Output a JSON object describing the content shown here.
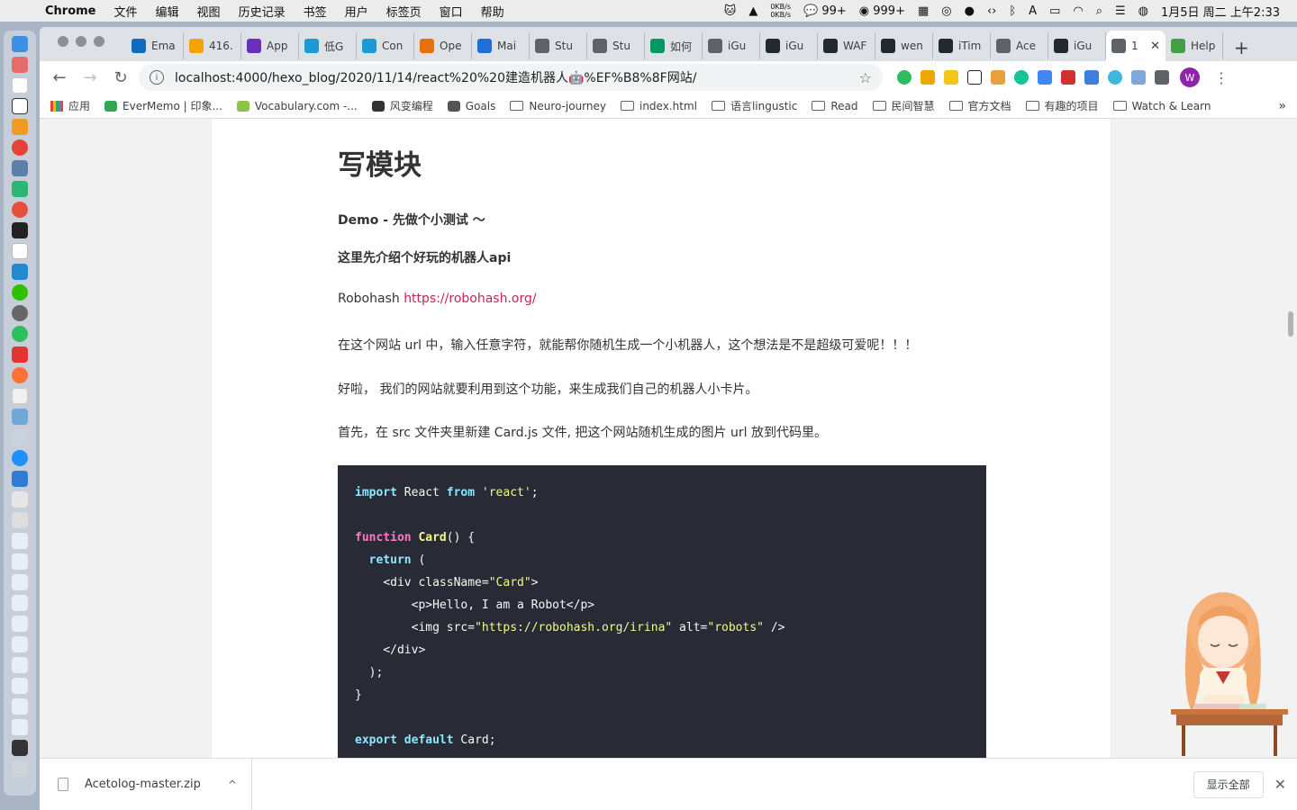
{
  "menubar": {
    "app_name": "Chrome",
    "items": [
      "文件",
      "编辑",
      "视图",
      "历史记录",
      "书签",
      "用户",
      "标签页",
      "窗口",
      "帮助"
    ],
    "net_up": "0KB/s",
    "net_down": "0KB/s",
    "wechat_count": "99+",
    "badge_count": "999+",
    "datetime": "1月5日 周二 上午2:33"
  },
  "tabs": [
    {
      "label": "Ema",
      "color": "#0f6cbd"
    },
    {
      "label": "416.",
      "color": "#f4a300"
    },
    {
      "label": "App",
      "color": "#6b2fbf"
    },
    {
      "label": "低G",
      "color": "#1a9bd7"
    },
    {
      "label": "Con",
      "color": "#1a9bd7"
    },
    {
      "label": "Ope",
      "color": "#e8710a"
    },
    {
      "label": "Mai",
      "color": "#1e6fd9"
    },
    {
      "label": "Stu",
      "color": "#5f6368"
    },
    {
      "label": "Stu",
      "color": "#5f6368"
    },
    {
      "label": "如何",
      "color": "#009a61"
    },
    {
      "label": "iGu",
      "color": "#5f6368"
    },
    {
      "label": "iGu",
      "color": "#24292e"
    },
    {
      "label": "WAF",
      "color": "#24292e"
    },
    {
      "label": "wen",
      "color": "#24292e"
    },
    {
      "label": "iTim",
      "color": "#24292e"
    },
    {
      "label": "Ace",
      "color": "#5f6368"
    },
    {
      "label": "iGu",
      "color": "#24292e"
    },
    {
      "label": "1",
      "color": "#5f6368",
      "active": true
    },
    {
      "label": "Help",
      "color": "#43a047"
    }
  ],
  "toolbar": {
    "url": "localhost:4000/hexo_blog/2020/11/14/react%20%20建造机器人🤖%EF%B8%8F网站/"
  },
  "bookmarks": [
    {
      "label": "应用",
      "type": "apps"
    },
    {
      "label": "EverMemo | 印象...",
      "type": "site",
      "color": "#2fa84f"
    },
    {
      "label": "Vocabulary.com -...",
      "type": "site",
      "color": "#8bc34a"
    },
    {
      "label": "风变编程",
      "type": "site",
      "color": "#333333"
    },
    {
      "label": "Goals",
      "type": "site",
      "color": "#555555"
    },
    {
      "label": "Neuro-journey",
      "type": "folder"
    },
    {
      "label": "index.html",
      "type": "folder"
    },
    {
      "label": "语言lingustic",
      "type": "folder"
    },
    {
      "label": "Read",
      "type": "folder"
    },
    {
      "label": "民间智慧",
      "type": "folder"
    },
    {
      "label": "官方文档",
      "type": "folder"
    },
    {
      "label": "有趣的项目",
      "type": "folder"
    },
    {
      "label": "Watch & Learn",
      "type": "folder"
    }
  ],
  "article": {
    "heading": "写模块",
    "p1": "Demo - 先做个小测试 ～",
    "p2": "这里先介绍个好玩的机器人api",
    "p3_prefix": "Robohash ",
    "p3_link": "https://robohash.org/",
    "p4": "在这个网站 url 中，输入任意字符，就能帮你随机生成一个小机器人，这个想法是不是超级可爱呢！！！",
    "p5": "好啦， 我们的网站就要利用到这个功能，来生成我们自己的机器人小卡片。",
    "p6": "首先，在 src 文件夹里新建 Card.js 文件, 把这个网站随机生成的图片 url 放到代码里。"
  },
  "code": {
    "l1_kw1": "import",
    "l1_mid": " React ",
    "l1_kw2": "from",
    "l1_str": "'react'",
    "l1_end": ";",
    "l3_kw": "function",
    "l3_fn": "Card",
    "l3_end": "() {",
    "l4_kw": "return",
    "l4_end": " (",
    "l5_a": "<div className=",
    "l5_str": "\"Card\"",
    "l5_b": ">",
    "l6": "<p>Hello, I am a Robot</p>",
    "l7_a": "<img src=",
    "l7_str1": "\"https://robohash.org/irina\"",
    "l7_b": " alt=",
    "l7_str2": "\"robots\"",
    "l7_c": " />",
    "l8": "</div>",
    "l9": ");",
    "l10": "}",
    "l12_kw1": "export",
    "l12_kw2": "default",
    "l12_end": " Card;"
  },
  "downloads": {
    "filename": "Acetolog-master.zip",
    "show_all": "显示全部"
  }
}
